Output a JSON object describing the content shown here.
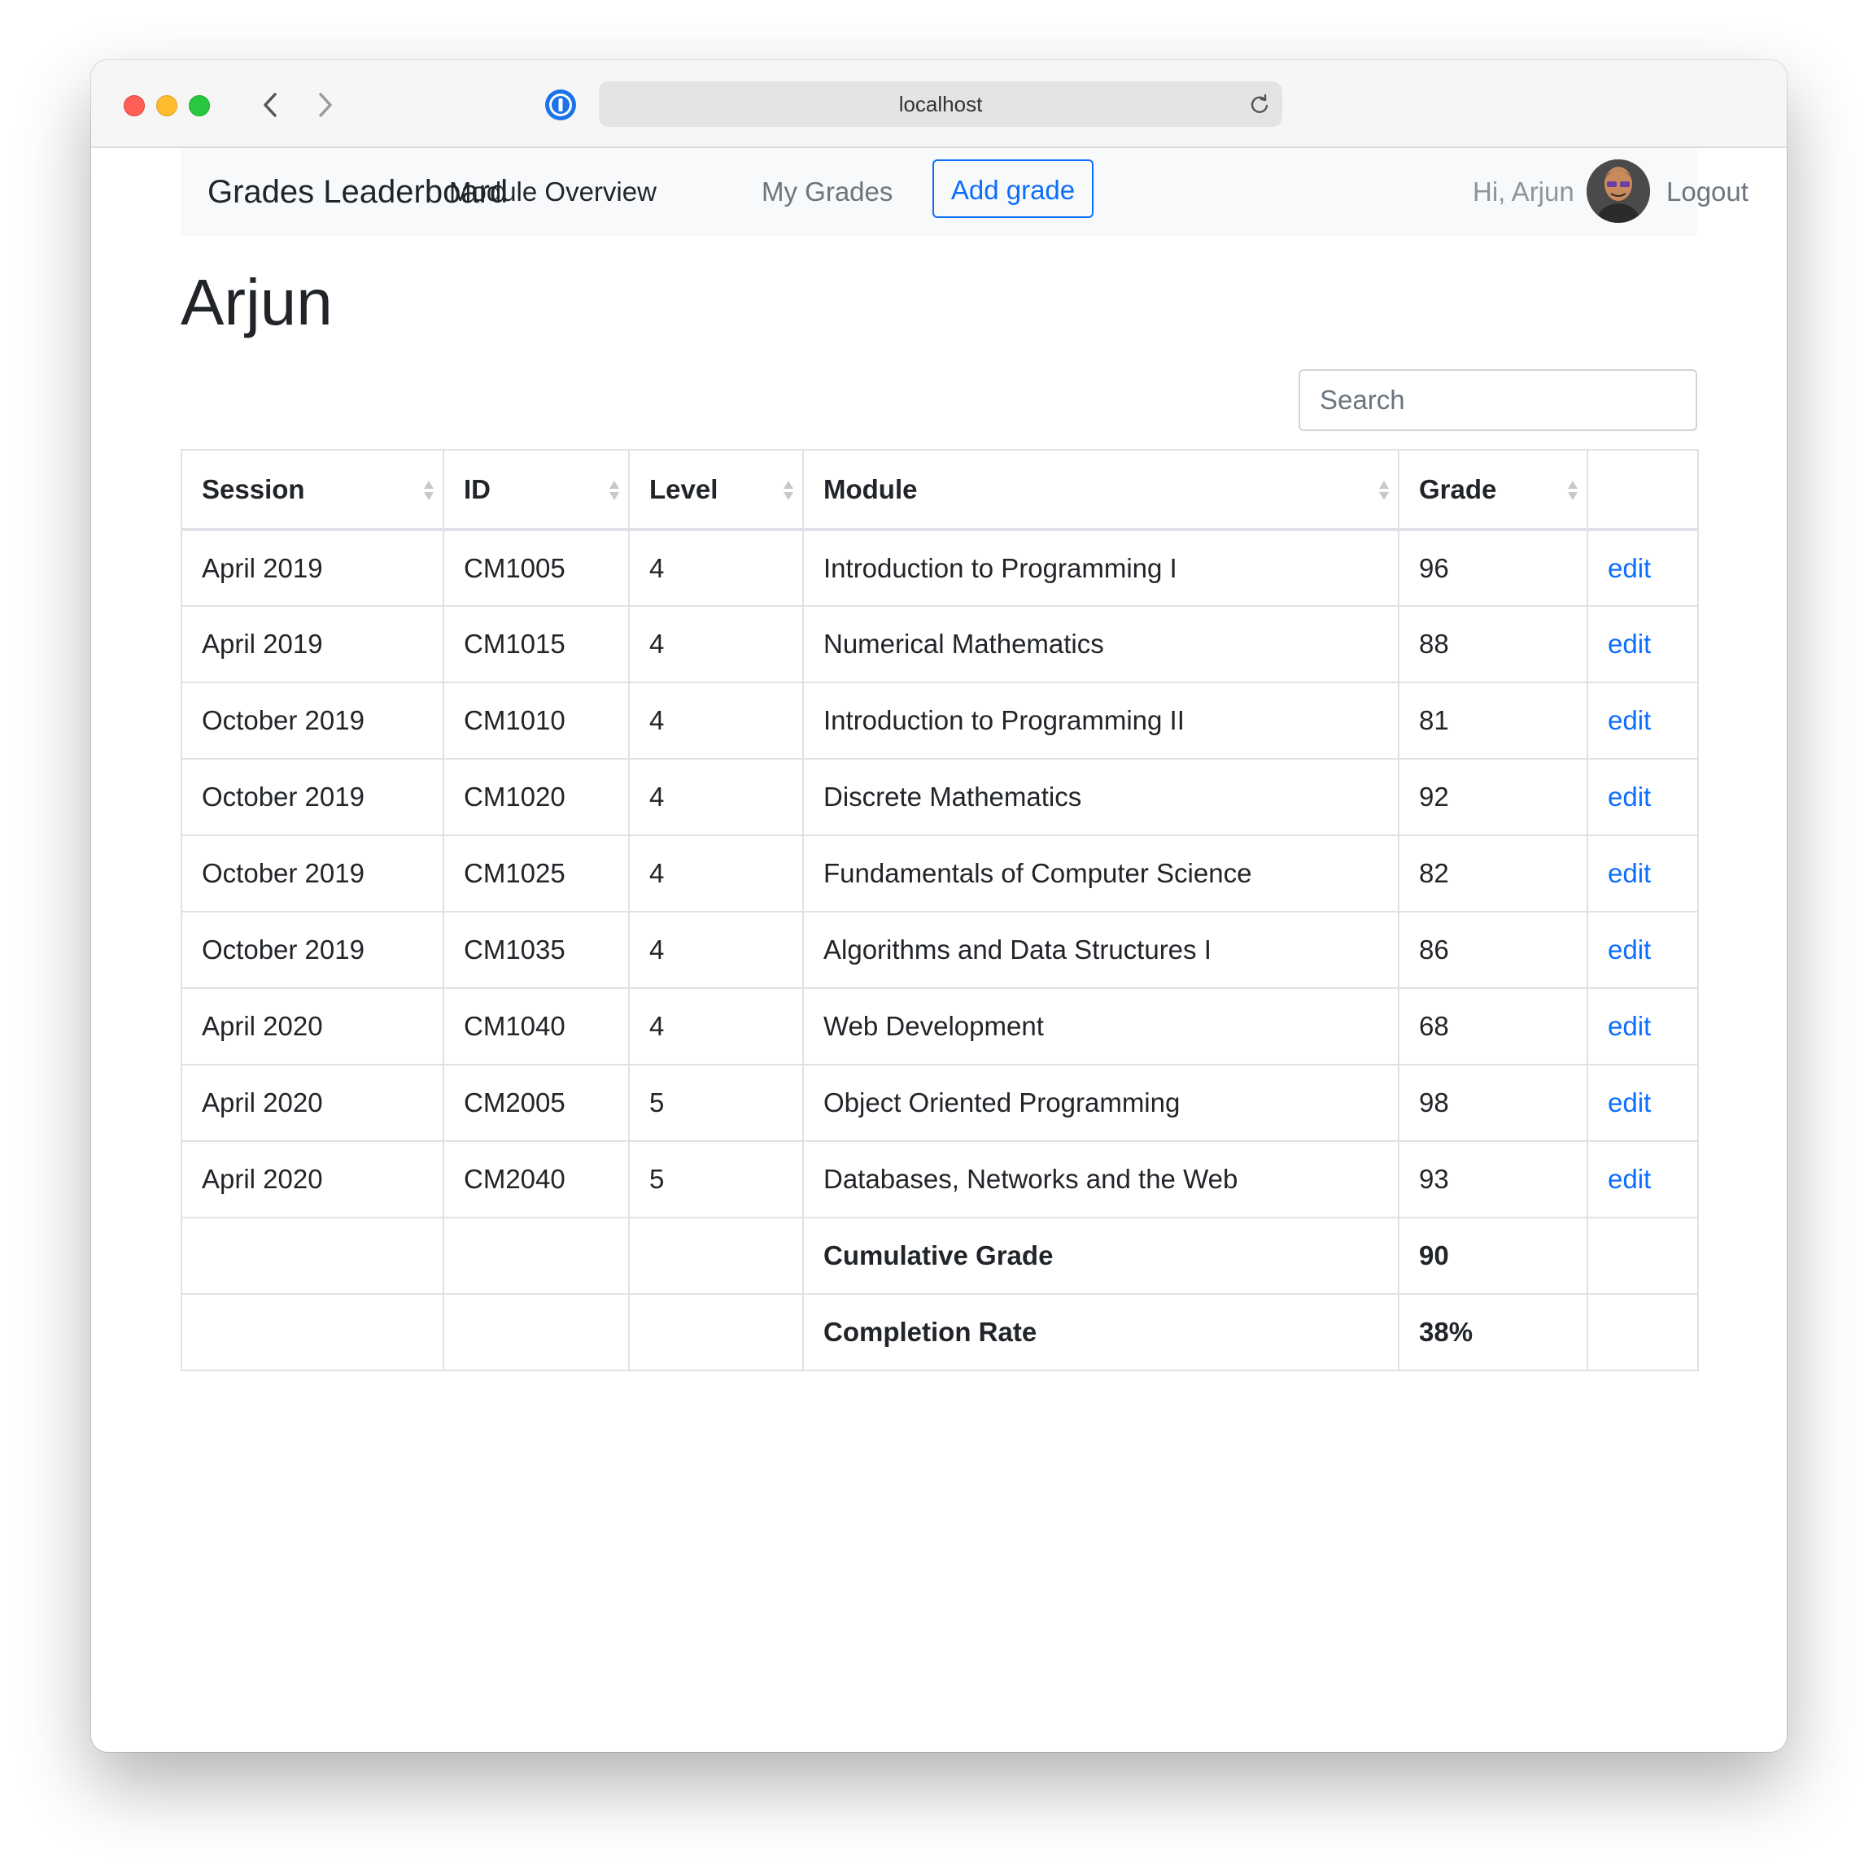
{
  "browser": {
    "url": "localhost"
  },
  "navbar": {
    "brand": "Grades Leaderboard",
    "links": [
      "Module Overview",
      "My Grades"
    ],
    "add_button": "Add grade",
    "greeting": "Hi, Arjun",
    "logout": "Logout"
  },
  "page": {
    "title": "Arjun",
    "search_placeholder": "Search"
  },
  "table": {
    "headers": [
      "Session",
      "ID",
      "Level",
      "Module",
      "Grade",
      ""
    ],
    "rows": [
      {
        "session": "April 2019",
        "id": "CM1005",
        "level": "4",
        "module": "Introduction to Programming I",
        "grade": "96",
        "action": "edit"
      },
      {
        "session": "April 2019",
        "id": "CM1015",
        "level": "4",
        "module": "Numerical Mathematics",
        "grade": "88",
        "action": "edit"
      },
      {
        "session": "October 2019",
        "id": "CM1010",
        "level": "4",
        "module": "Introduction to Programming II",
        "grade": "81",
        "action": "edit"
      },
      {
        "session": "October 2019",
        "id": "CM1020",
        "level": "4",
        "module": "Discrete Mathematics",
        "grade": "92",
        "action": "edit"
      },
      {
        "session": "October 2019",
        "id": "CM1025",
        "level": "4",
        "module": "Fundamentals of Computer Science",
        "grade": "82",
        "action": "edit"
      },
      {
        "session": "October 2019",
        "id": "CM1035",
        "level": "4",
        "module": "Algorithms and Data Structures I",
        "grade": "86",
        "action": "edit"
      },
      {
        "session": "April 2020",
        "id": "CM1040",
        "level": "4",
        "module": "Web Development",
        "grade": "68",
        "action": "edit"
      },
      {
        "session": "April 2020",
        "id": "CM2005",
        "level": "5",
        "module": "Object Oriented Programming",
        "grade": "98",
        "action": "edit"
      },
      {
        "session": "April 2020",
        "id": "CM2040",
        "level": "5",
        "module": "Databases, Networks and the Web",
        "grade": "93",
        "action": "edit"
      }
    ],
    "summary": [
      {
        "label": "Cumulative Grade",
        "value": "90"
      },
      {
        "label": "Completion Rate",
        "value": "38%"
      }
    ]
  },
  "colors": {
    "link": "#0d6efd",
    "navbar_bg": "#f8f9fa",
    "text": "#212529",
    "muted": "#6c757d"
  }
}
